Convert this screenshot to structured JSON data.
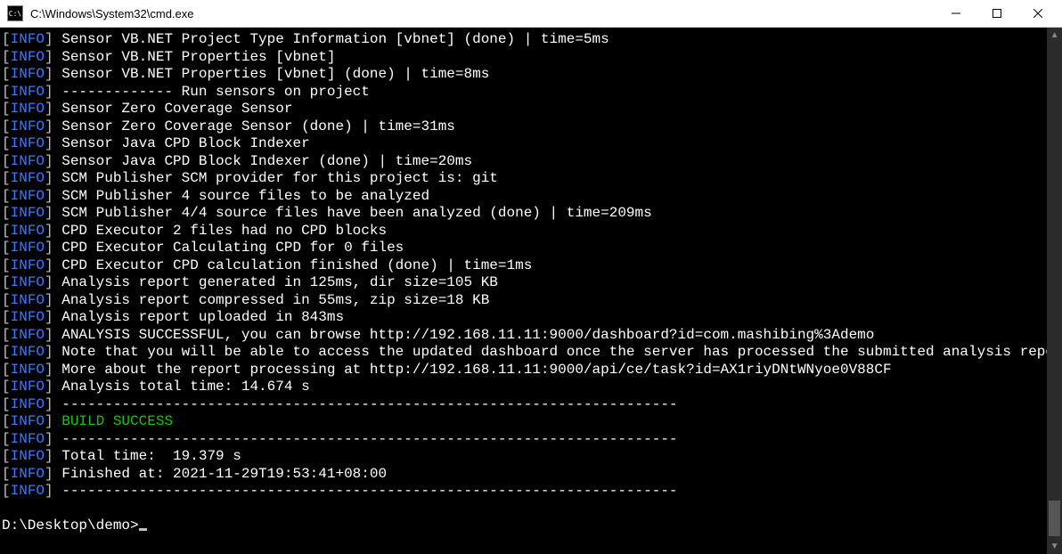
{
  "window": {
    "title": "C:\\Windows\\System32\\cmd.exe",
    "icon_glyph": "C:\\"
  },
  "controls": {
    "minimize": "—",
    "maximize": "□",
    "close": "×"
  },
  "prompt": "D:\\Desktop\\demo>",
  "dashes": "------------------------------------------------------------------------",
  "lines": [
    {
      "level": "INFO",
      "text": "Sensor VB.NET Project Type Information [vbnet] (done) | time=5ms"
    },
    {
      "level": "INFO",
      "text": "Sensor VB.NET Properties [vbnet]"
    },
    {
      "level": "INFO",
      "text": "Sensor VB.NET Properties [vbnet] (done) | time=8ms"
    },
    {
      "level": "INFO",
      "text": "------------- Run sensors on project"
    },
    {
      "level": "INFO",
      "text": "Sensor Zero Coverage Sensor"
    },
    {
      "level": "INFO",
      "text": "Sensor Zero Coverage Sensor (done) | time=31ms"
    },
    {
      "level": "INFO",
      "text": "Sensor Java CPD Block Indexer"
    },
    {
      "level": "INFO",
      "text": "Sensor Java CPD Block Indexer (done) | time=20ms"
    },
    {
      "level": "INFO",
      "text": "SCM Publisher SCM provider for this project is: git"
    },
    {
      "level": "INFO",
      "text": "SCM Publisher 4 source files to be analyzed"
    },
    {
      "level": "INFO",
      "text": "SCM Publisher 4/4 source files have been analyzed (done) | time=209ms"
    },
    {
      "level": "INFO",
      "text": "CPD Executor 2 files had no CPD blocks"
    },
    {
      "level": "INFO",
      "text": "CPD Executor Calculating CPD for 0 files"
    },
    {
      "level": "INFO",
      "text": "CPD Executor CPD calculation finished (done) | time=1ms"
    },
    {
      "level": "INFO",
      "text": "Analysis report generated in 125ms, dir size=105 KB"
    },
    {
      "level": "INFO",
      "text": "Analysis report compressed in 55ms, zip size=18 KB"
    },
    {
      "level": "INFO",
      "text": "Analysis report uploaded in 843ms"
    },
    {
      "level": "INFO",
      "text": "ANALYSIS SUCCESSFUL, you can browse http://192.168.11.11:9000/dashboard?id=com.mashibing%3Ademo"
    },
    {
      "level": "INFO",
      "wrap": true,
      "text": "Note that you will be able to access the updated dashboard once the server has processed the submitted analysis report"
    },
    {
      "level": "INFO",
      "text": "More about the report processing at http://192.168.11.11:9000/api/ce/task?id=AX1riyDNtWNyoe0V88CF"
    },
    {
      "level": "INFO",
      "text": "Analysis total time: 14.674 s"
    },
    {
      "level": "INFO",
      "dash": true
    },
    {
      "level": "INFO",
      "success": true,
      "text": "BUILD SUCCESS"
    },
    {
      "level": "INFO",
      "dash": true
    },
    {
      "level": "INFO",
      "text": "Total time:  19.379 s"
    },
    {
      "level": "INFO",
      "text": "Finished at: 2021-11-29T19:53:41+08:00"
    },
    {
      "level": "INFO",
      "dash": true
    }
  ]
}
